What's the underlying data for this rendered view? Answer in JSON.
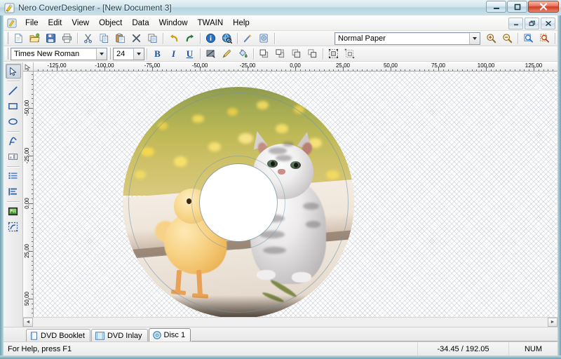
{
  "window": {
    "title": "Nero CoverDesigner - [New Document 3]",
    "app_icon": "nero-coverdesigner-icon",
    "buttons": {
      "minimize": "–",
      "maximize": "□",
      "close": "✕"
    },
    "mdi_buttons": {
      "minimize": "–",
      "restore": "❐",
      "close": "✕"
    }
  },
  "menu": {
    "items": [
      {
        "label": "File"
      },
      {
        "label": "Edit"
      },
      {
        "label": "View"
      },
      {
        "label": "Object"
      },
      {
        "label": "Data"
      },
      {
        "label": "Window"
      },
      {
        "label": "TWAIN"
      },
      {
        "label": "Help"
      }
    ]
  },
  "toolbar_main": {
    "buttons": [
      {
        "name": "new",
        "icon": "new-document-icon",
        "tooltip": "New"
      },
      {
        "name": "open",
        "icon": "open-folder-icon",
        "tooltip": "Open"
      },
      {
        "name": "save",
        "icon": "floppy-save-icon",
        "tooltip": "Save"
      },
      {
        "name": "print",
        "icon": "printer-icon",
        "tooltip": "Print"
      },
      {
        "name": "cut",
        "icon": "scissors-icon",
        "tooltip": "Cut"
      },
      {
        "name": "copy",
        "icon": "copy-icon",
        "tooltip": "Copy"
      },
      {
        "name": "paste",
        "icon": "paste-icon",
        "tooltip": "Paste"
      },
      {
        "name": "delete",
        "icon": "delete-x-icon",
        "tooltip": "Delete"
      },
      {
        "name": "duplicate",
        "icon": "duplicate-icon",
        "tooltip": "Duplicate"
      },
      {
        "name": "undo",
        "icon": "undo-arrow-icon",
        "tooltip": "Undo"
      },
      {
        "name": "redo",
        "icon": "redo-arrow-icon",
        "tooltip": "Redo"
      },
      {
        "name": "info",
        "icon": "info-icon",
        "tooltip": "Document Info"
      },
      {
        "name": "preview",
        "icon": "preview-globe-icon",
        "tooltip": "Preview"
      },
      {
        "name": "wizard",
        "icon": "wizard-wand-icon",
        "tooltip": "Wizard"
      },
      {
        "name": "cover-template",
        "icon": "cover-template-icon",
        "tooltip": "Cover Template"
      }
    ],
    "paper_combo": {
      "value": "Normal Paper",
      "name": "paper-type-combo"
    },
    "zoom_buttons": [
      {
        "name": "zoom-in",
        "icon": "zoom-in-icon"
      },
      {
        "name": "zoom-out",
        "icon": "zoom-out-icon"
      },
      {
        "name": "zoom-fit-page",
        "icon": "zoom-page-icon"
      },
      {
        "name": "zoom-fit-selection",
        "icon": "zoom-selection-icon"
      }
    ]
  },
  "toolbar_format": {
    "font_combo": {
      "value": "Times New Roman",
      "name": "font-family-combo"
    },
    "size_combo": {
      "value": "24",
      "name": "font-size-combo"
    },
    "bold": {
      "label": "B",
      "name": "bold-button"
    },
    "italic": {
      "label": "I",
      "name": "italic-button"
    },
    "underline": {
      "label": "U",
      "name": "underline-button"
    },
    "buttons": [
      {
        "name": "no-fill",
        "icon": "no-fill-icon"
      },
      {
        "name": "pen-color",
        "icon": "pen-icon"
      },
      {
        "name": "fill-color",
        "icon": "paint-bucket-icon"
      },
      {
        "name": "bring-to-front",
        "icon": "bring-to-front-icon"
      },
      {
        "name": "bring-forward",
        "icon": "bring-forward-icon"
      },
      {
        "name": "send-backward",
        "icon": "send-backward-icon"
      },
      {
        "name": "send-to-back",
        "icon": "send-to-back-icon"
      },
      {
        "name": "group",
        "icon": "group-icon"
      },
      {
        "name": "ungroup",
        "icon": "ungroup-icon"
      }
    ]
  },
  "palette": {
    "tools": [
      {
        "name": "select-tool",
        "icon": "cursor-arrow-icon",
        "active": true
      },
      {
        "name": "line-tool",
        "icon": "line-icon",
        "active": false
      },
      {
        "name": "rectangle-tool",
        "icon": "rectangle-icon",
        "active": false
      },
      {
        "name": "ellipse-tool",
        "icon": "ellipse-icon",
        "active": false
      },
      {
        "name": "artistic-text-tool",
        "icon": "artistic-text-a-icon",
        "active": false
      },
      {
        "name": "text-box-tool",
        "icon": "text-box-icon",
        "active": false
      },
      {
        "name": "track-list-tool",
        "icon": "track-list-icon",
        "active": false
      },
      {
        "name": "field-tool",
        "icon": "field-icon",
        "active": false
      },
      {
        "name": "image-tool",
        "icon": "image-icon",
        "active": false
      },
      {
        "name": "mask-tool",
        "icon": "mask-select-icon",
        "active": false
      }
    ]
  },
  "rulers": {
    "unit": "mm",
    "horizontal": {
      "labels": [
        "-125,00",
        "-100,00",
        "-75,00",
        "-50,00",
        "-25,00",
        "0,00",
        "25,00",
        "50,00",
        "75,00",
        "100,00",
        "125,00"
      ],
      "values": [
        -125,
        -100,
        -75,
        -50,
        -25,
        0,
        25,
        50,
        75,
        100,
        125
      ]
    },
    "vertical": {
      "labels": [
        "-50,00",
        "-25,00",
        "0,00",
        "25,00",
        "50,00"
      ],
      "values": [
        -50,
        -25,
        0,
        25,
        50
      ]
    }
  },
  "canvas": {
    "object_name": "disc-image",
    "image_description": "photo of a grey tabby kitten and a yellow duckling on a white bench in a meadow",
    "hole_label": "disc-center-hole"
  },
  "tabs": {
    "items": [
      {
        "label": "DVD Booklet",
        "icon": "booklet-icon",
        "active": false
      },
      {
        "label": "DVD Inlay",
        "icon": "inlay-icon",
        "active": false
      },
      {
        "label": "Disc 1",
        "icon": "disc-icon",
        "active": true
      }
    ]
  },
  "statusbar": {
    "help": "For Help, press F1",
    "coordinates": "-34.45 / 192.05",
    "num_lock": "NUM"
  },
  "scrollbar": {
    "left_arrow": "◄",
    "right_arrow": "►"
  },
  "colors": {
    "title_text": "#1b3a4a",
    "close_button": "#cf3c24",
    "accent_blue": "#2a5fa8",
    "canvas_grid": "#96a0af"
  }
}
